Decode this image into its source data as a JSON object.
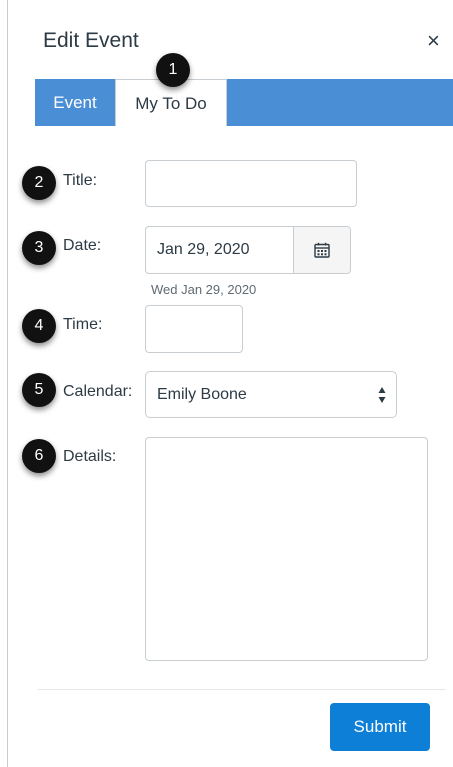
{
  "dialog": {
    "title": "Edit Event",
    "close_glyph": "×"
  },
  "tabs": [
    {
      "label": "Event"
    },
    {
      "label": "My To Do"
    }
  ],
  "badges": [
    "1",
    "2",
    "3",
    "4",
    "5",
    "6"
  ],
  "form": {
    "title_label": "Title:",
    "title_value": "",
    "date_label": "Date:",
    "date_value": "Jan 29, 2020",
    "date_hint": "Wed Jan 29, 2020",
    "time_label": "Time:",
    "time_value": "",
    "calendar_label": "Calendar:",
    "calendar_value": "Emily Boone",
    "details_label": "Details:",
    "details_value": ""
  },
  "submit_label": "Submit",
  "colors": {
    "tab_bar": "#4a8fd6",
    "submit": "#0e7fd6",
    "badge": "#111111"
  }
}
